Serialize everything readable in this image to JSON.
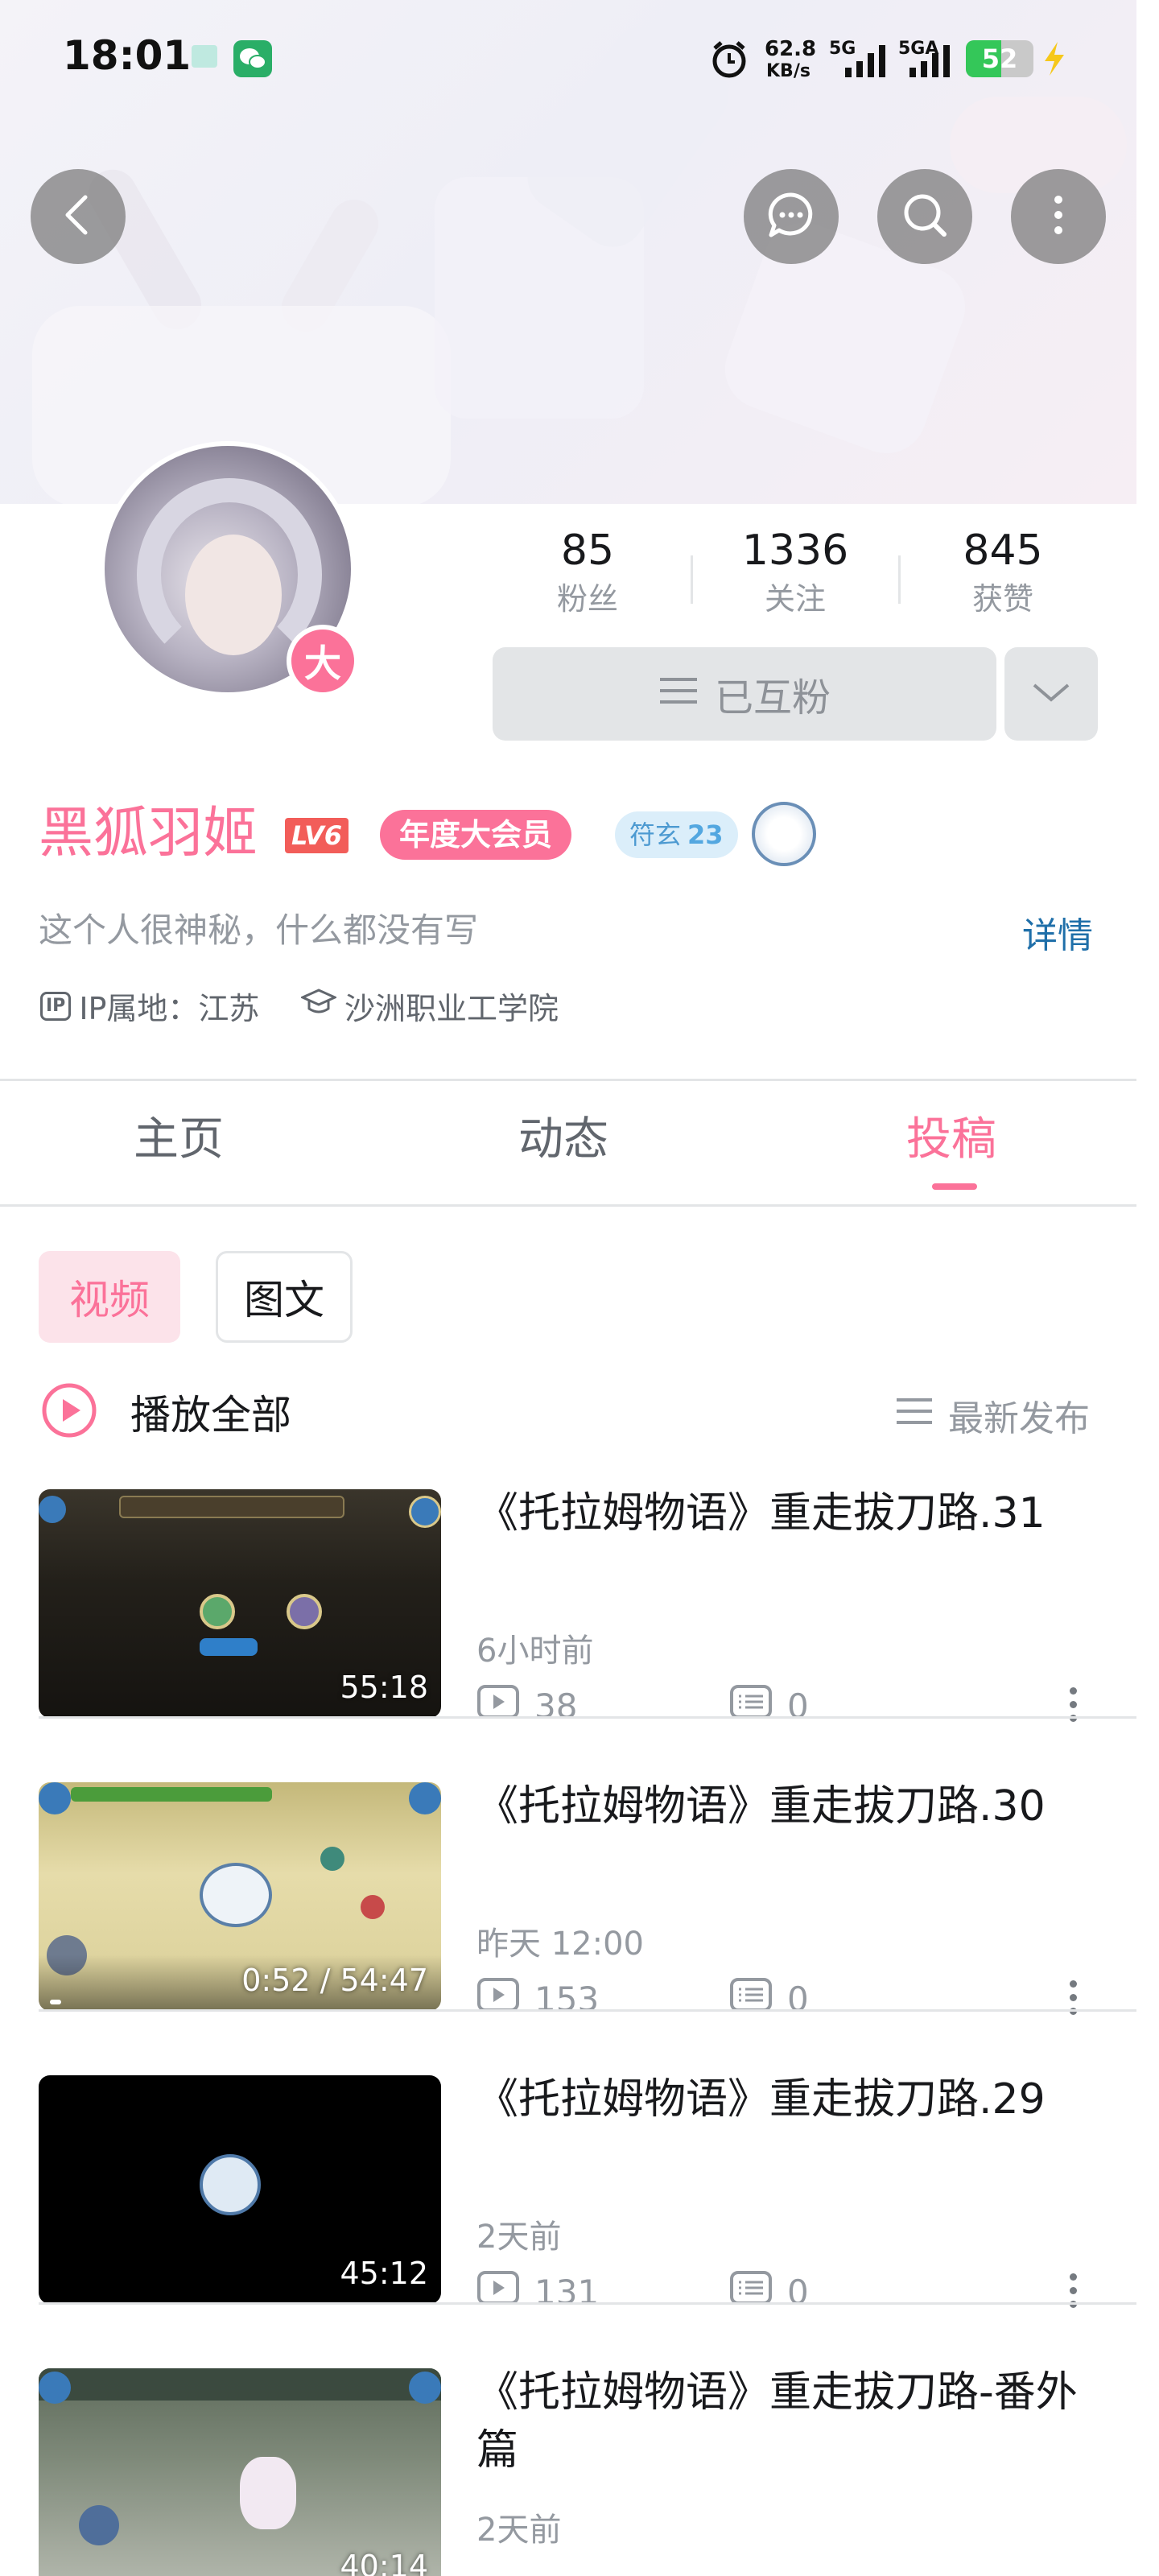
{
  "status_bar": {
    "time": "18:01",
    "net_speed_value": "62.8",
    "net_speed_unit": "KB/s",
    "signal_1": "5G",
    "signal_2": "5GA",
    "battery": "52",
    "battery_fraction": 0.52
  },
  "header": {
    "back_icon": "chevron-left-icon",
    "message_icon": "chat-bubble-icon",
    "search_icon": "search-icon",
    "more_icon": "more-vertical-icon"
  },
  "profile": {
    "avatar_badge": "大",
    "fans_count": "85",
    "fans_label": "粉丝",
    "following_count": "1336",
    "following_label": "关注",
    "likes_count": "845",
    "likes_label": "获赞",
    "follow_status": "已互粉",
    "name": "黑狐羽姬",
    "level": "LV6",
    "vip_tag": "年度大会员",
    "medal_name": "符玄",
    "medal_level": "23",
    "signature": "这个人很神秘，什么都没有写",
    "detail_link": "详情",
    "ip_icon_text": "IP",
    "ip_location": "IP属地：江苏",
    "school": "沙洲职业工学院"
  },
  "tabs": [
    {
      "label": "主页",
      "active": false
    },
    {
      "label": "动态",
      "active": false
    },
    {
      "label": "投稿",
      "active": true
    }
  ],
  "filters": {
    "video": "视频",
    "article": "图文"
  },
  "list_header": {
    "play_all": "播放全部",
    "sort": "最新发布"
  },
  "videos": [
    {
      "title": "《托拉姆物语》重走拔刀路.31",
      "time": "6小时前",
      "plays": "38",
      "comments": "0",
      "duration": "55:18"
    },
    {
      "title": "《托拉姆物语》重走拔刀路.30",
      "time": "昨天 12:00",
      "plays": "153",
      "comments": "0",
      "duration": "0:52 / 54:47"
    },
    {
      "title": "《托拉姆物语》重走拔刀路.29",
      "time": "2天前",
      "plays": "131",
      "comments": "0",
      "duration": "45:12"
    },
    {
      "title": "《托拉姆物语》重走拔刀路-番外篇",
      "time": "2天前",
      "plays": "",
      "comments": "",
      "duration": "40:14"
    }
  ],
  "colors": {
    "accent": "#fb7299",
    "link": "#1f6fa9",
    "level_red": "#f25d59"
  }
}
